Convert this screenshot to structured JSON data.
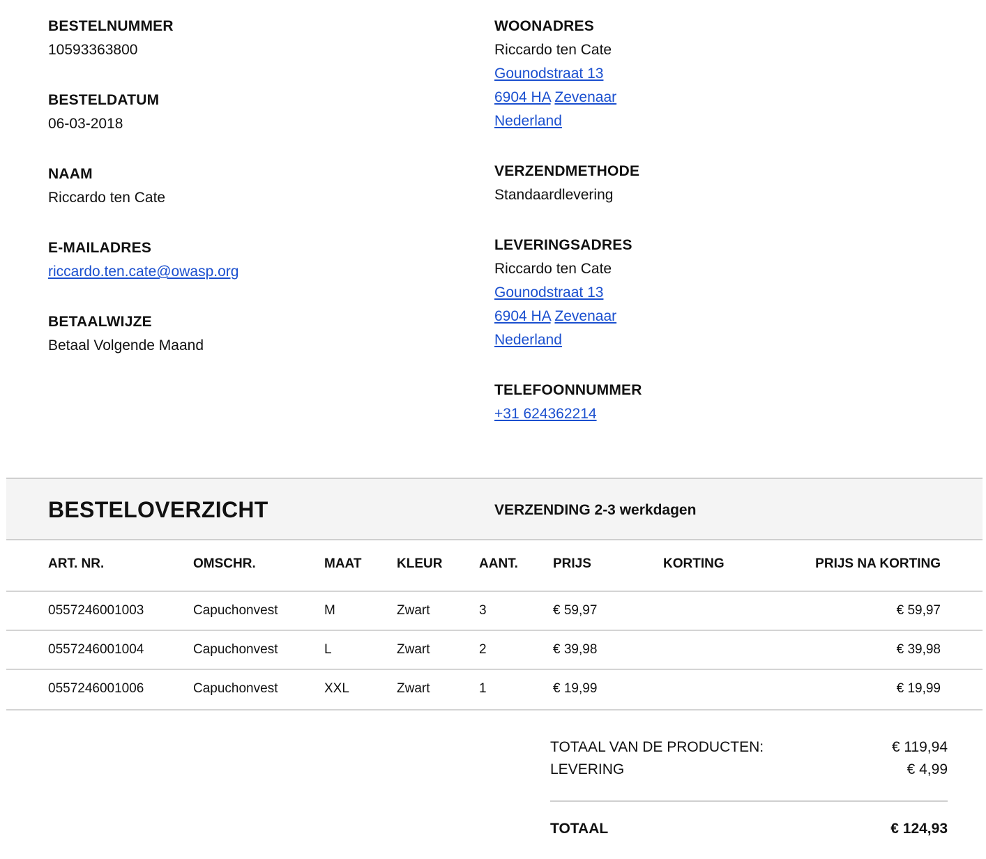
{
  "order": {
    "number_label": "BESTELNUMMER",
    "number": "10593363800",
    "date_label": "BESTELDATUM",
    "date": "06-03-2018",
    "name_label": "NAAM",
    "name": "Riccardo ten Cate",
    "email_label": "E-MAILADRES",
    "email": "riccardo.ten.cate@owasp.org",
    "payment_label": "BETAALWIJZE",
    "payment": "Betaal Volgende Maand"
  },
  "home_address": {
    "label": "WOONADRES",
    "name": "Riccardo ten Cate",
    "street": "Gounodstraat 13",
    "postcode": "6904 HA",
    "city": "Zevenaar",
    "country": "Nederland"
  },
  "shipping_method": {
    "label": "VERZENDMETHODE",
    "value": "Standaardlevering"
  },
  "delivery_address": {
    "label": "LEVERINGSADRES",
    "name": "Riccardo ten Cate",
    "street": "Gounodstraat 13",
    "postcode": "6904 HA",
    "city": "Zevenaar",
    "country": "Nederland"
  },
  "phone": {
    "label": "TELEFOONNUMMER",
    "value": "+31 624362214"
  },
  "overview": {
    "title": "BESTELOVERZICHT",
    "shipping_note": "VERZENDING 2-3 werkdagen"
  },
  "table": {
    "headers": [
      "ART. NR.",
      "OMSCHR.",
      "MAAT",
      "KLEUR",
      "AANT.",
      "PRIJS",
      "KORTING",
      "PRIJS NA KORTING"
    ],
    "rows": [
      [
        "0557246001003",
        "Capuchonvest",
        "M",
        "Zwart",
        "3",
        "€ 59,97",
        "",
        "€ 59,97"
      ],
      [
        "0557246001004",
        "Capuchonvest",
        "L",
        "Zwart",
        "2",
        "€ 39,98",
        "",
        "€ 39,98"
      ],
      [
        "0557246001006",
        "Capuchonvest",
        "XXL",
        "Zwart",
        "1",
        "€ 19,99",
        "",
        "€ 19,99"
      ]
    ]
  },
  "totals": {
    "products_label": "TOTAAL VAN DE PRODUCTEN:",
    "products_value": "€ 119,94",
    "delivery_label": "LEVERING",
    "delivery_value": "€ 4,99",
    "total_label": "TOTAAL",
    "total_value": "€ 124,93"
  },
  "colors": {
    "link": "#1a4fcf",
    "text": "#111111",
    "header_band": "#f4f4f4",
    "divider": "#d4d4d4"
  }
}
